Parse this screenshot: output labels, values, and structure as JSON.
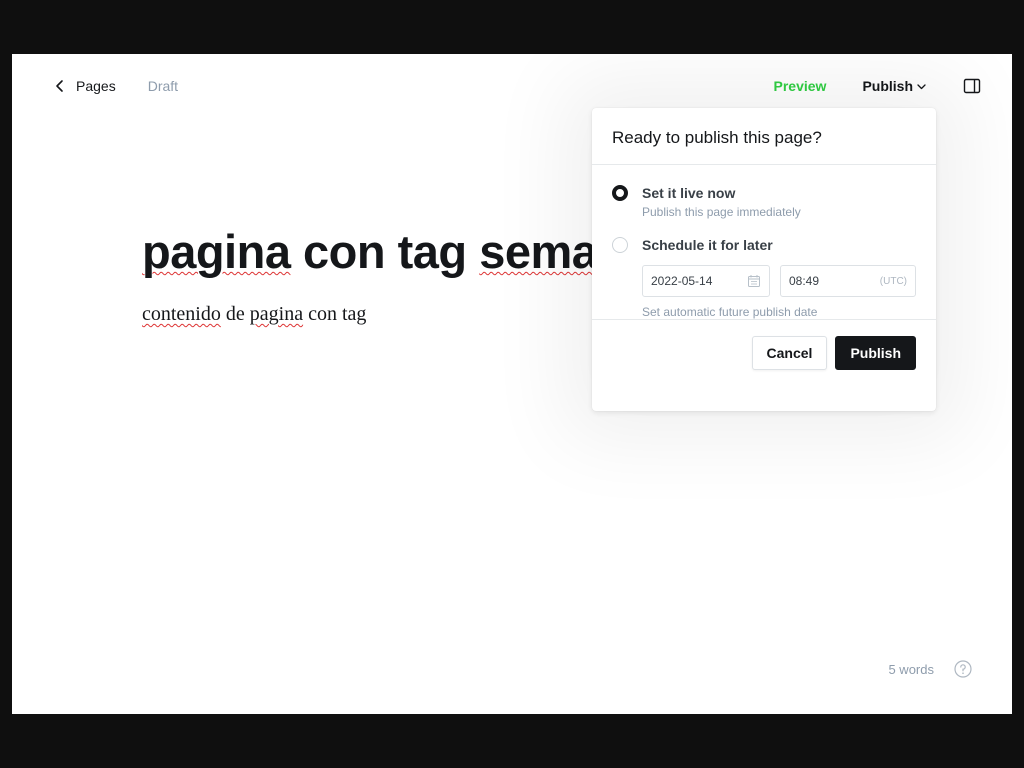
{
  "header": {
    "back_label": "Pages",
    "status": "Draft",
    "preview_label": "Preview",
    "publish_label": "Publish",
    "icons": {
      "back": "chevron-left-icon",
      "publish_dropdown": "chevron-down-icon",
      "settings": "sidebar-toggle-icon"
    }
  },
  "editor": {
    "title": "pagina con tag sema",
    "body_words": [
      "contenido",
      "de",
      "pagina",
      "con",
      "tag"
    ],
    "misspelled_words": [
      "pagina",
      "sema",
      "contenido"
    ]
  },
  "publish_menu": {
    "heading": "Ready to publish this page?",
    "options": [
      {
        "label": "Set it live now",
        "help": "Publish this page immediately",
        "selected": true
      },
      {
        "label": "Schedule it for later",
        "selected": false
      }
    ],
    "schedule": {
      "date": "2022-05-14",
      "time": "08:49",
      "timezone": "(UTC)",
      "help": "Set automatic future publish date",
      "date_icon": "calendar-icon"
    },
    "cancel_label": "Cancel",
    "publish_label": "Publish"
  },
  "footer": {
    "word_count": "5 words",
    "help_icon": "help-circle-icon"
  },
  "colors": {
    "accent_green": "#30cf43",
    "dark": "#15171a",
    "muted": "#8e9cac",
    "page_background": "#ffffff",
    "outer_background": "#0f0f0f"
  }
}
